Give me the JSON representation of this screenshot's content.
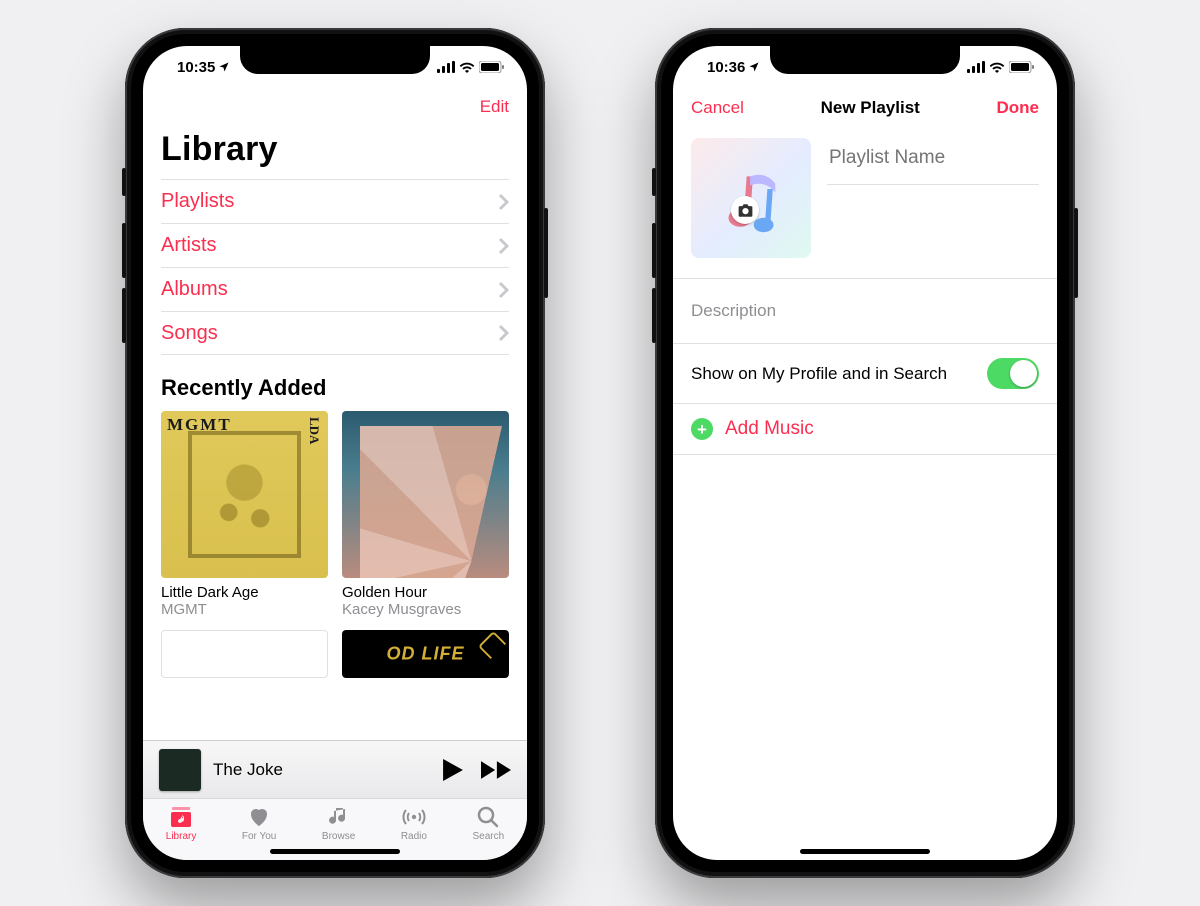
{
  "left": {
    "status_time": "10:35",
    "nav_edit": "Edit",
    "title": "Library",
    "menu": [
      {
        "label": "Playlists"
      },
      {
        "label": "Artists"
      },
      {
        "label": "Albums"
      },
      {
        "label": "Songs"
      }
    ],
    "section_title": "Recently Added",
    "albums": [
      {
        "title": "Little Dark Age",
        "artist": "MGMT",
        "cover_tag_tl": "MGMT",
        "cover_tag_tr": "LDA"
      },
      {
        "title": "Golden Hour",
        "artist": "Kacey Musgraves"
      }
    ],
    "peek_text": "OD LIFE",
    "now_playing": {
      "title": "The Joke"
    },
    "tabs": [
      {
        "label": "Library"
      },
      {
        "label": "For You"
      },
      {
        "label": "Browse"
      },
      {
        "label": "Radio"
      },
      {
        "label": "Search"
      }
    ]
  },
  "right": {
    "status_time": "10:36",
    "nav_cancel": "Cancel",
    "nav_title": "New Playlist",
    "nav_done": "Done",
    "name_placeholder": "Playlist Name",
    "description_placeholder": "Description",
    "toggle_label": "Show on My Profile and in Search",
    "toggle_on": true,
    "add_music_label": "Add Music"
  }
}
